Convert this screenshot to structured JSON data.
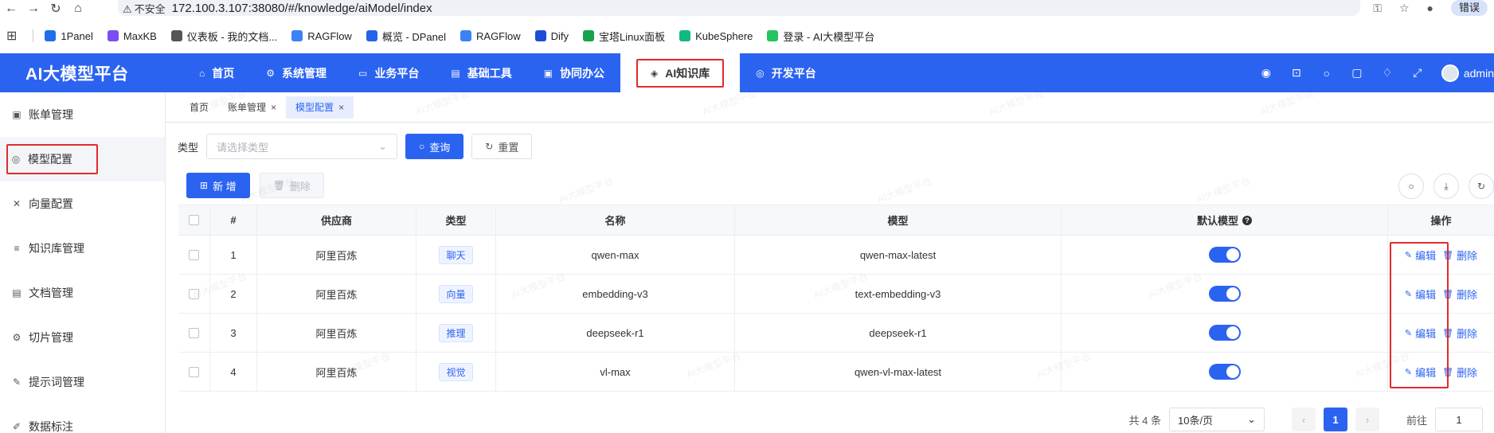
{
  "browser": {
    "insecure_label": "不安全",
    "url": "172.100.3.107:38080/#/knowledge/aiModel/index",
    "profile_label": "错误"
  },
  "bookmarks": [
    {
      "label": "1Panel",
      "color": "#1f6feb"
    },
    {
      "label": "MaxKB",
      "color": "#7b4df5"
    },
    {
      "label": "仪表板 - 我的文档...",
      "color": "#555555"
    },
    {
      "label": "RAGFlow",
      "color": "#3b82f6"
    },
    {
      "label": "概览 - DPanel",
      "color": "#2563eb"
    },
    {
      "label": "RAGFlow",
      "color": "#3b82f6"
    },
    {
      "label": "Dify",
      "color": "#1d4ed8"
    },
    {
      "label": "宝塔Linux面板",
      "color": "#16a34a"
    },
    {
      "label": "KubeSphere",
      "color": "#10b981"
    },
    {
      "label": "登录 - AI大模型平台",
      "color": "#22c55e"
    }
  ],
  "app": {
    "title": "AI大模型平台",
    "user": "admin",
    "accent": "#2b63f1"
  },
  "topnav": [
    {
      "label": "首页",
      "icon": "home-icon",
      "glyph": "⌂"
    },
    {
      "label": "系统管理",
      "icon": "settings-icon",
      "glyph": "⚙"
    },
    {
      "label": "业务平台",
      "icon": "monitor-icon",
      "glyph": "▭"
    },
    {
      "label": "基础工具",
      "icon": "toolbox-icon",
      "glyph": "▤"
    },
    {
      "label": "协同办公",
      "icon": "office-icon",
      "glyph": "▣"
    },
    {
      "label": "AI知识库",
      "icon": "graduation-icon",
      "glyph": "◈",
      "active": true
    },
    {
      "label": "开发平台",
      "icon": "cube-icon",
      "glyph": "◎"
    }
  ],
  "sidebar": [
    {
      "label": "账单管理",
      "icon": "bill-icon",
      "glyph": "▣"
    },
    {
      "label": "模型配置",
      "icon": "model-icon",
      "glyph": "◎",
      "active": true
    },
    {
      "label": "向量配置",
      "icon": "vector-icon",
      "glyph": "✕"
    },
    {
      "label": "知识库管理",
      "icon": "database-icon",
      "glyph": "≡"
    },
    {
      "label": "文档管理",
      "icon": "document-icon",
      "glyph": "▤"
    },
    {
      "label": "切片管理",
      "icon": "slice-icon",
      "glyph": "⚙"
    },
    {
      "label": "提示词管理",
      "icon": "prompt-icon",
      "glyph": "✎"
    },
    {
      "label": "数据标注",
      "icon": "annotate-icon",
      "glyph": "✐"
    }
  ],
  "tags": [
    {
      "label": "首页",
      "closable": false
    },
    {
      "label": "账单管理",
      "closable": true
    },
    {
      "label": "模型配置",
      "closable": true,
      "active": true
    }
  ],
  "search": {
    "type_label": "类型",
    "type_placeholder": "请选择类型",
    "query_label": "查询",
    "reset_label": "重置"
  },
  "toolbar": {
    "add_label": "新 增",
    "delete_label": "删除"
  },
  "table": {
    "columns": [
      "#",
      "供应商",
      "类型",
      "名称",
      "模型",
      "默认模型",
      "操作"
    ],
    "rows": [
      {
        "idx": "1",
        "supplier": "阿里百炼",
        "type": "聊天",
        "name": "qwen-max",
        "model": "qwen-max-latest",
        "default": true
      },
      {
        "idx": "2",
        "supplier": "阿里百炼",
        "type": "向量",
        "name": "embedding-v3",
        "model": "text-embedding-v3",
        "default": true
      },
      {
        "idx": "3",
        "supplier": "阿里百炼",
        "type": "推理",
        "name": "deepseek-r1",
        "model": "deepseek-r1",
        "default": true
      },
      {
        "idx": "4",
        "supplier": "阿里百炼",
        "type": "视觉",
        "name": "vl-max",
        "model": "qwen-vl-max-latest",
        "default": true
      }
    ],
    "edit_label": "编辑",
    "delete_label": "删除"
  },
  "pagination": {
    "total_label": "共 4 条",
    "page_size": "10条/页",
    "current_page": "1",
    "goto_label": "前往",
    "goto_value": "1"
  },
  "watermark": "AI大模型平台"
}
